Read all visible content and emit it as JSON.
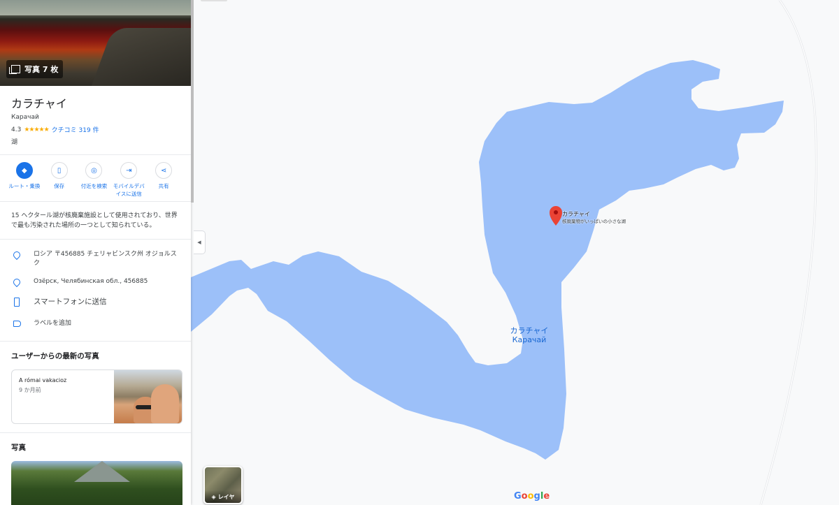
{
  "place": {
    "photos_label": "写真 7 枚",
    "title": "カラチャイ",
    "subtitle": "Карачай",
    "rating": "4.3",
    "stars": "★★★★★",
    "reviews_link": "クチコミ 319 件",
    "category": "湖"
  },
  "actions": [
    {
      "label": "ルート・乗換",
      "icon": "directions-icon"
    },
    {
      "label": "保存",
      "icon": "bookmark-icon"
    },
    {
      "label": "付近を検索",
      "icon": "nearby-icon"
    },
    {
      "label": "モバイルデバイスに送信",
      "icon": "send-to-phone-icon"
    },
    {
      "label": "共有",
      "icon": "share-icon"
    }
  ],
  "description": "15 ヘクタール湖が核廃棄施設として使用されており、世界で最も汚染された場所の一つとして知られている。",
  "info": {
    "address_ja": "ロシア 〒456885 チェリャビンスク州 オジョルスク",
    "address_ru": "Озёрск, Челябинская обл., 456885",
    "send_phone": "スマートフォンに送信",
    "add_label": "ラベルを追加"
  },
  "user_photos": {
    "section_title": "ユーザーからの最新の写真",
    "card_title": "A római vakacioz",
    "card_time": "9 か月前"
  },
  "photos_section_title": "写真",
  "map": {
    "marker_title": "カラチャイ",
    "marker_subtitle": "核廃棄物がいっぱいの小さな湖",
    "lake_label_ja": "カラチャイ",
    "lake_label_ru": "Карачай",
    "layers_label": "レイヤ",
    "water_color": "#9cc0f9",
    "land_color": "#f8f9fa",
    "marker_color": "#ea4335"
  },
  "google_logo": [
    "G",
    "o",
    "o",
    "g",
    "l",
    "e"
  ]
}
